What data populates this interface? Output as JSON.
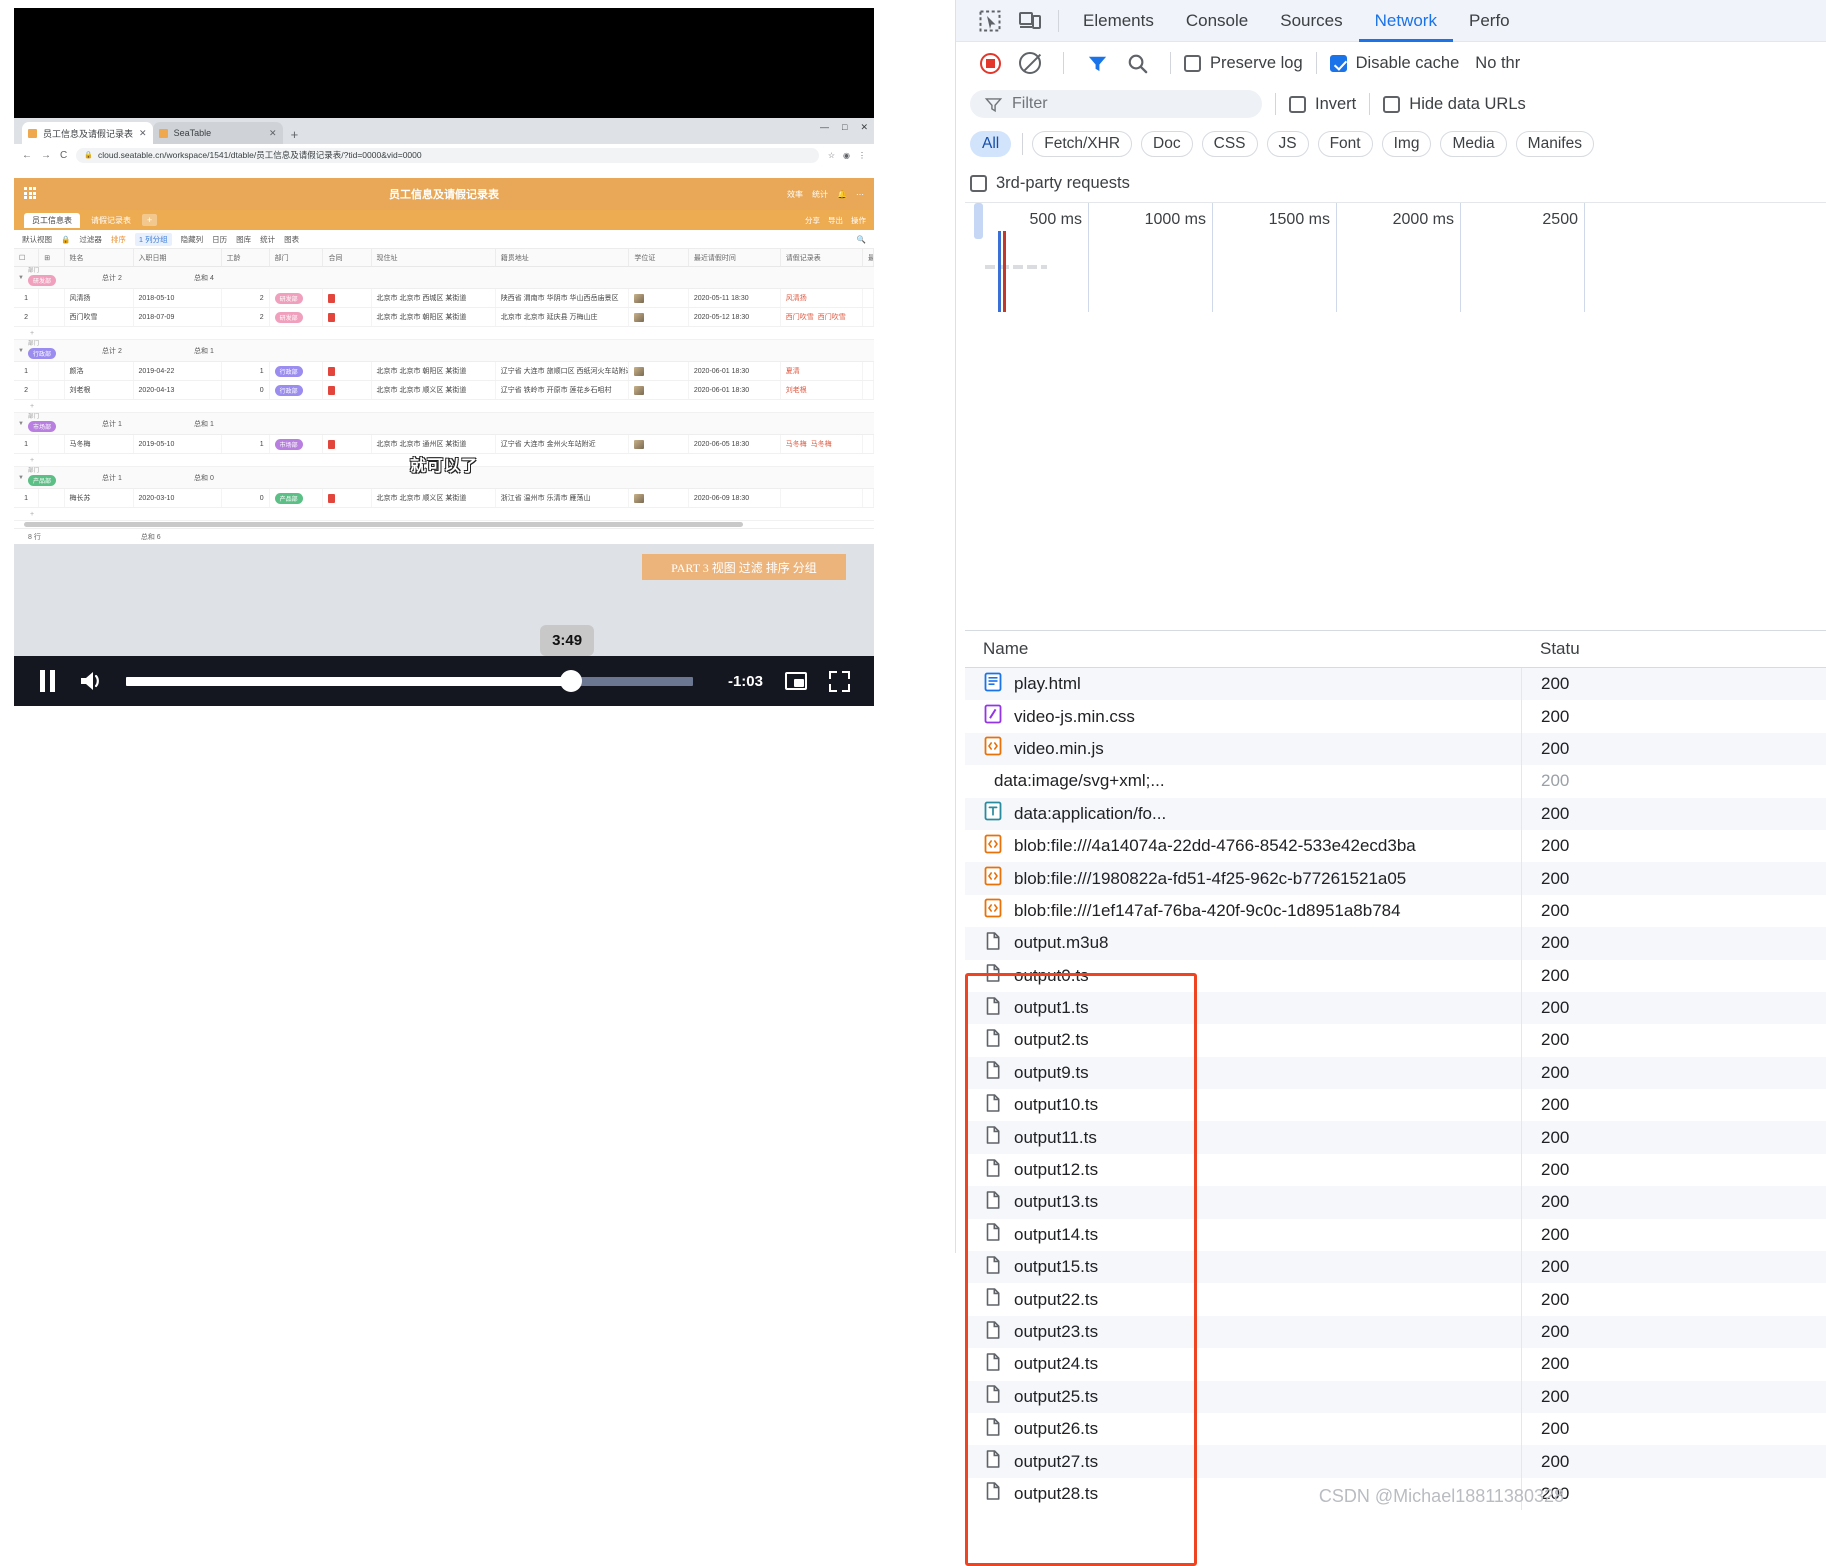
{
  "video": {
    "tooltip_time": "3:49",
    "remaining_time": "-1:03",
    "progress_percent": 78.5,
    "controls": {
      "pause": "pause-button",
      "volume": "volume-button",
      "pip": "picture-in-picture-button",
      "fullscreen": "fullscreen-button"
    }
  },
  "recorded_browser": {
    "tabs": [
      {
        "title": "员工信息及请假记录表",
        "active": true
      },
      {
        "title": "SeaTable",
        "active": false
      }
    ],
    "new_tab_label": "+",
    "window_buttons": [
      "—",
      "□",
      "✕"
    ],
    "nav": {
      "back": "←",
      "forward": "→",
      "reload": "C"
    },
    "url": "cloud.seatable.cn/workspace/1541/dtable/员工信息及请假记录表/?tid=0000&vid=0000",
    "lock_icon": "lock-icon"
  },
  "seatable": {
    "app_title": "员工信息及请假记录表",
    "header_right": [
      "效率",
      "统计",
      "⋯"
    ],
    "tabs": [
      {
        "label": "员工信息表",
        "active": true
      },
      {
        "label": "请假记录表",
        "active": false
      }
    ],
    "tab_add": "+",
    "tabs_right": [
      "分享",
      "导出",
      "操作"
    ],
    "toolbar": [
      {
        "label": "默认视图",
        "kind": "normal"
      },
      {
        "label": "过滤器",
        "kind": "normal"
      },
      {
        "label": "排序",
        "kind": "orange"
      },
      {
        "label": "1 列分组",
        "kind": "blue"
      },
      {
        "label": "隐藏列",
        "kind": "normal"
      },
      {
        "label": "日历",
        "kind": "normal"
      },
      {
        "label": "图库",
        "kind": "normal"
      },
      {
        "label": "统计",
        "kind": "normal"
      },
      {
        "label": "图表",
        "kind": "normal"
      }
    ],
    "columns": [
      "姓名",
      "入职日期",
      "工龄",
      "部门",
      "合同",
      "现住址",
      "籍贯地址",
      "学位证",
      "最近请假时间",
      "请假记录表",
      "最近请"
    ],
    "groups": [
      {
        "name": "研发部",
        "color": "#f0a0bd",
        "count_label": "总计 2",
        "sum_label": "总和 4",
        "rows": [
          {
            "idx": "1",
            "name": "风清扬",
            "date": "2018-05-10",
            "num": "2",
            "dept": "研发部",
            "addr1": "北京市 北京市 西城区 某街道",
            "addr2": "陕西省 渭南市 华阴市 华山西岳庙景区",
            "time": "2020-05-11 18:30",
            "links": [
              "风清扬"
            ]
          },
          {
            "idx": "2",
            "name": "西门吹雪",
            "date": "2018-07-09",
            "num": "2",
            "dept": "研发部",
            "addr1": "北京市 北京市 朝阳区 某街道",
            "addr2": "北京市 北京市 延庆县 万梅山庄",
            "time": "2020-05-12 18:30",
            "links": [
              "西门吹雪",
              "西门吹雪"
            ]
          }
        ]
      },
      {
        "name": "行政部",
        "color": "#9b8cf0",
        "count_label": "总计 2",
        "sum_label": "总和 1",
        "rows": [
          {
            "idx": "1",
            "name": "颜洛",
            "date": "2019-04-22",
            "num": "1",
            "dept": "行政部",
            "addr1": "北京市 北京市 朝阳区 某街道",
            "addr2": "辽宁省 大连市 旅顺口区 西纸河火车站附近",
            "time": "2020-06-01 18:30",
            "links": [
              "夏清"
            ]
          },
          {
            "idx": "2",
            "name": "刘老根",
            "date": "2020-04-13",
            "num": "0",
            "dept": "行政部",
            "addr1": "北京市 北京市 顺义区 某街道",
            "addr2": "辽宁省 铁岭市 开原市 莲花乡石咀村",
            "time": "2020-06-01 18:30",
            "links": [
              "刘老根"
            ]
          }
        ]
      },
      {
        "name": "市场部",
        "color": "#b97fe0",
        "count_label": "总计 1",
        "sum_label": "总和 1",
        "rows": [
          {
            "idx": "1",
            "name": "马冬梅",
            "date": "2019-05-10",
            "num": "1",
            "dept": "市场部",
            "addr1": "北京市 北京市 通州区 某街道",
            "addr2": "辽宁省 大连市 金州火车站附近",
            "time": "2020-06-05 18:30",
            "links": [
              "马冬梅",
              "马冬梅"
            ]
          }
        ]
      },
      {
        "name": "产品部",
        "color": "#5bbf86",
        "count_label": "总计 1",
        "sum_label": "总和 0",
        "rows": [
          {
            "idx": "1",
            "name": "梅长苏",
            "date": "2020-03-10",
            "num": "0",
            "dept": "产品部",
            "addr1": "北京市 北京市 顺义区 某街道",
            "addr2": "浙江省 温州市 乐清市 雁荡山",
            "time": "2020-06-09 18:30",
            "links": []
          }
        ]
      }
    ],
    "add_row_label": "+",
    "footer": {
      "rows": "8 行",
      "sum": "总和 6"
    }
  },
  "overlay": {
    "subtitle": "就可以了",
    "part_banner": "PART 3 视图 过滤  排序  分组"
  },
  "devtools": {
    "panel_tabs": [
      {
        "label": "Elements",
        "active": false
      },
      {
        "label": "Console",
        "active": false
      },
      {
        "label": "Sources",
        "active": false
      },
      {
        "label": "Network",
        "active": true
      },
      {
        "label": "Perfo",
        "active": false
      }
    ],
    "icons": {
      "inspect": "inspect-element-icon",
      "device": "device-toolbar-icon",
      "record": "record-stop-icon",
      "clear": "clear-network-log-icon",
      "filter": "filter-icon",
      "search": "search-icon"
    },
    "toolbar": {
      "preserve_log": "Preserve log",
      "preserve_log_checked": false,
      "disable_cache": "Disable cache",
      "disable_cache_checked": true,
      "throttling": "No thr"
    },
    "filter": {
      "placeholder": "Filter",
      "invert": "Invert",
      "invert_checked": false,
      "hide_data_urls": "Hide data URLs",
      "hide_data_urls_checked": false
    },
    "type_chips": [
      {
        "label": "All",
        "active": true
      },
      {
        "label": "Fetch/XHR",
        "active": false
      },
      {
        "label": "Doc",
        "active": false
      },
      {
        "label": "CSS",
        "active": false
      },
      {
        "label": "JS",
        "active": false
      },
      {
        "label": "Font",
        "active": false
      },
      {
        "label": "Img",
        "active": false
      },
      {
        "label": "Media",
        "active": false
      },
      {
        "label": "Manifes",
        "active": false
      }
    ],
    "third_party": "3rd-party requests",
    "third_party_checked": false,
    "timeline": {
      "ticks": [
        "500 ms",
        "1000 ms",
        "1500 ms",
        "2000 ms",
        "2500"
      ]
    },
    "table": {
      "headers": {
        "name": "Name",
        "status": "Statu"
      },
      "rows": [
        {
          "name": "play.html",
          "status": "200",
          "type": "doc",
          "dim": false
        },
        {
          "name": "video-js.min.css",
          "status": "200",
          "type": "css",
          "dim": false
        },
        {
          "name": "video.min.js",
          "status": "200",
          "type": "js",
          "dim": false
        },
        {
          "name": "data:image/svg+xml;...",
          "status": "200",
          "type": "none",
          "dim": true
        },
        {
          "name": "data:application/fo...",
          "status": "200",
          "type": "font",
          "dim": false
        },
        {
          "name": "blob:file:///4a14074a-22dd-4766-8542-533e42ecd3ba",
          "status": "200",
          "type": "js",
          "dim": false
        },
        {
          "name": "blob:file:///1980822a-fd51-4f25-962c-b77261521a05",
          "status": "200",
          "type": "js",
          "dim": false
        },
        {
          "name": "blob:file:///1ef147af-76ba-420f-9c0c-1d8951a8b784",
          "status": "200",
          "type": "js",
          "dim": false
        },
        {
          "name": "output.m3u8",
          "status": "200",
          "type": "file",
          "dim": false
        },
        {
          "name": "output0.ts",
          "status": "200",
          "type": "file",
          "dim": false
        },
        {
          "name": "output1.ts",
          "status": "200",
          "type": "file",
          "dim": false
        },
        {
          "name": "output2.ts",
          "status": "200",
          "type": "file",
          "dim": false
        },
        {
          "name": "output9.ts",
          "status": "200",
          "type": "file",
          "dim": false
        },
        {
          "name": "output10.ts",
          "status": "200",
          "type": "file",
          "dim": false
        },
        {
          "name": "output11.ts",
          "status": "200",
          "type": "file",
          "dim": false
        },
        {
          "name": "output12.ts",
          "status": "200",
          "type": "file",
          "dim": false
        },
        {
          "name": "output13.ts",
          "status": "200",
          "type": "file",
          "dim": false
        },
        {
          "name": "output14.ts",
          "status": "200",
          "type": "file",
          "dim": false
        },
        {
          "name": "output15.ts",
          "status": "200",
          "type": "file",
          "dim": false
        },
        {
          "name": "output22.ts",
          "status": "200",
          "type": "file",
          "dim": false
        },
        {
          "name": "output23.ts",
          "status": "200",
          "type": "file",
          "dim": false
        },
        {
          "name": "output24.ts",
          "status": "200",
          "type": "file",
          "dim": false
        },
        {
          "name": "output25.ts",
          "status": "200",
          "type": "file",
          "dim": false
        },
        {
          "name": "output26.ts",
          "status": "200",
          "type": "file",
          "dim": false
        },
        {
          "name": "output27.ts",
          "status": "200",
          "type": "file",
          "dim": false
        },
        {
          "name": "output28.ts",
          "status": "200",
          "type": "file",
          "dim": false
        }
      ]
    },
    "highlight_color": "#ee4422"
  },
  "watermark": "CSDN @Michael18811380328"
}
